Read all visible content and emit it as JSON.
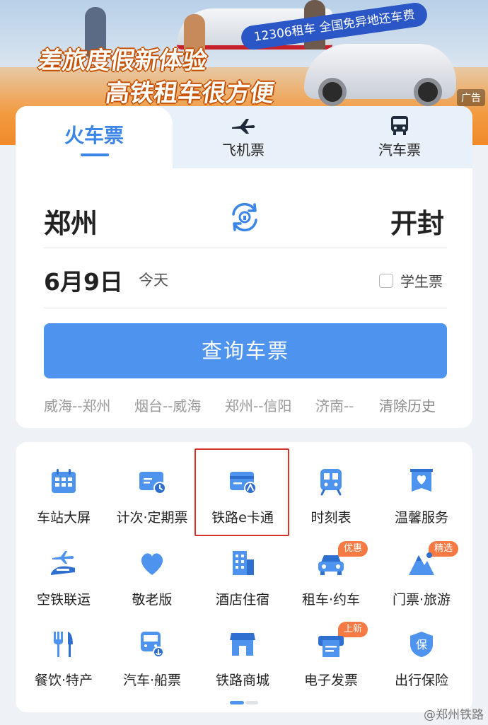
{
  "banner": {
    "tagline": "12306租车 全国免异地还车费",
    "headline_1": "差旅度假新体验",
    "headline_2": "高铁租车很方便",
    "ad_label": "广告"
  },
  "tabs": {
    "train": "火车票",
    "flight": "飞机票",
    "bus": "汽车票"
  },
  "route": {
    "from": "郑州",
    "to": "开封"
  },
  "date": {
    "value": "6月9日",
    "relative": "今天"
  },
  "student_ticket": {
    "label": "学生票",
    "checked": false
  },
  "search_button": "查询车票",
  "history": {
    "items": [
      "威海--郑州",
      "烟台--威海",
      "郑州--信阳",
      "济南--"
    ],
    "clear": "清除历史"
  },
  "services": [
    {
      "label": "车站大屏",
      "icon": "station-screen-icon"
    },
    {
      "label": "计次·定期票",
      "icon": "ticket-card-icon"
    },
    {
      "label": "铁路e卡通",
      "icon": "railway-ecard-icon"
    },
    {
      "label": "时刻表",
      "icon": "timetable-train-icon"
    },
    {
      "label": "温馨服务",
      "icon": "heart-service-icon"
    },
    {
      "label": "空铁联运",
      "icon": "air-rail-icon"
    },
    {
      "label": "敬老版",
      "icon": "heart-icon"
    },
    {
      "label": "酒店住宿",
      "icon": "hotel-icon"
    },
    {
      "label": "租车·约车",
      "icon": "car-icon",
      "badge": "优惠"
    },
    {
      "label": "门票·旅游",
      "icon": "mountain-icon",
      "badge": "精选"
    },
    {
      "label": "餐饮·特产",
      "icon": "dining-icon"
    },
    {
      "label": "汽车·船票",
      "icon": "bus-ship-icon"
    },
    {
      "label": "铁路商城",
      "icon": "shop-icon"
    },
    {
      "label": "电子发票",
      "icon": "invoice-icon",
      "badge": "上新"
    },
    {
      "label": "出行保险",
      "icon": "insurance-shield-icon"
    }
  ],
  "watermark": "@郑州铁路",
  "colors": {
    "accent": "#4e93ee",
    "tab_active": "#3b85e6",
    "badge": "#f57a43",
    "highlight_box": "#d6312b"
  }
}
